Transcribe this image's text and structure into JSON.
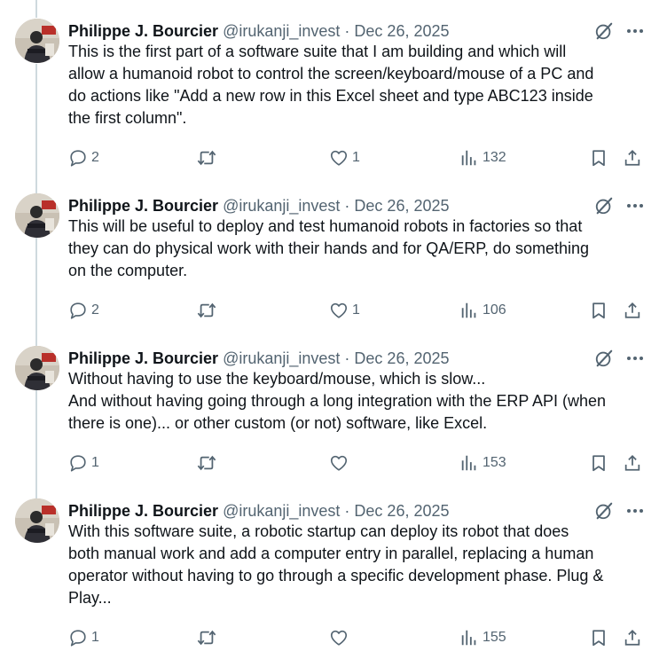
{
  "tweets": [
    {
      "name": "Philippe J. Bourcier",
      "handle": "@irukanji_invest",
      "dot": "·",
      "date": "Dec 26, 2025",
      "lines": [
        "This is the first part of a software suite that I am building and which will",
        "allow a humanoid robot to control the screen/keyboard/mouse of a PC and",
        "do actions like \"Add a new row in this Excel sheet and type ABC123 inside",
        "the first column\"."
      ],
      "replies": "2",
      "reposts": "",
      "likes": "1",
      "views": "132"
    },
    {
      "name": "Philippe J. Bourcier",
      "handle": "@irukanji_invest",
      "dot": "·",
      "date": "Dec 26, 2025",
      "lines": [
        "This will be useful to deploy and test humanoid robots in factories so that",
        "they can do physical work with their hands and for QA/ERP, do something",
        "on the computer."
      ],
      "replies": "2",
      "reposts": "",
      "likes": "1",
      "views": "106"
    },
    {
      "name": "Philippe J. Bourcier",
      "handle": "@irukanji_invest",
      "dot": "·",
      "date": "Dec 26, 2025",
      "lines": [
        "Without having to use the keyboard/mouse, which is slow...",
        "And without having going through a long integration with the ERP API (when",
        "there is one)... or other custom (or not) software, like Excel."
      ],
      "replies": "1",
      "reposts": "",
      "likes": "",
      "views": "153"
    },
    {
      "name": "Philippe J. Bourcier",
      "handle": "@irukanji_invest",
      "dot": "·",
      "date": "Dec 26, 2025",
      "lines": [
        "With this software suite, a robotic startup can deploy its robot that does",
        "both manual work and add a computer entry in parallel, replacing a human",
        "operator without having to go through a specific development phase. Plug &",
        "Play..."
      ],
      "replies": "1",
      "reposts": "",
      "likes": "",
      "views": "155"
    }
  ],
  "icons": {
    "grok": "grok-icon",
    "more": "more-icon",
    "reply": "reply-icon",
    "repost": "repost-icon",
    "like": "like-icon",
    "views": "views-icon",
    "bookmark": "bookmark-icon",
    "share": "share-icon"
  },
  "colors": {
    "text": "#0f1419",
    "secondary": "#536471",
    "thread_line": "#cfd9de"
  }
}
